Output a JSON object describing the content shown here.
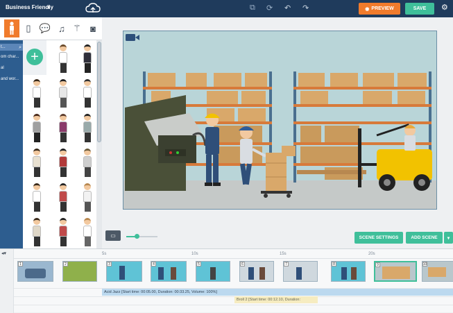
{
  "topbar": {
    "title": "Business Friendly",
    "preview_label": "PREVIEW",
    "save_label": "SAVE"
  },
  "sidebar": {
    "categories": [
      {
        "label": "t...",
        "selected": true
      },
      {
        "label": "om char...",
        "selected": false
      },
      {
        "label": "al",
        "selected": false
      },
      {
        "label": "and wor...",
        "selected": false
      }
    ]
  },
  "scene": {
    "settings_label": "SCENE SETTINGS",
    "add_scene_label": "ADD SCENE"
  },
  "timeline": {
    "ruler_ticks": [
      "5s",
      "10s",
      "15s",
      "20s"
    ],
    "audio_track": "Acid Jazz [Start time: 00:05.00, Duration: 00:33.25, Volume: 100%]",
    "broll_track": "Broll 2 [Start time: 00:12.10, Duration:",
    "thumb_numbers": [
      "1",
      "2",
      "3",
      "4",
      "5",
      "6",
      "7",
      "8",
      "9",
      "10"
    ]
  },
  "colors": {
    "topbar": "#1f3b5c",
    "accent_orange": "#f07b2c",
    "accent_green": "#3fbf9a",
    "sidebar_blue": "#2d5d8f"
  }
}
